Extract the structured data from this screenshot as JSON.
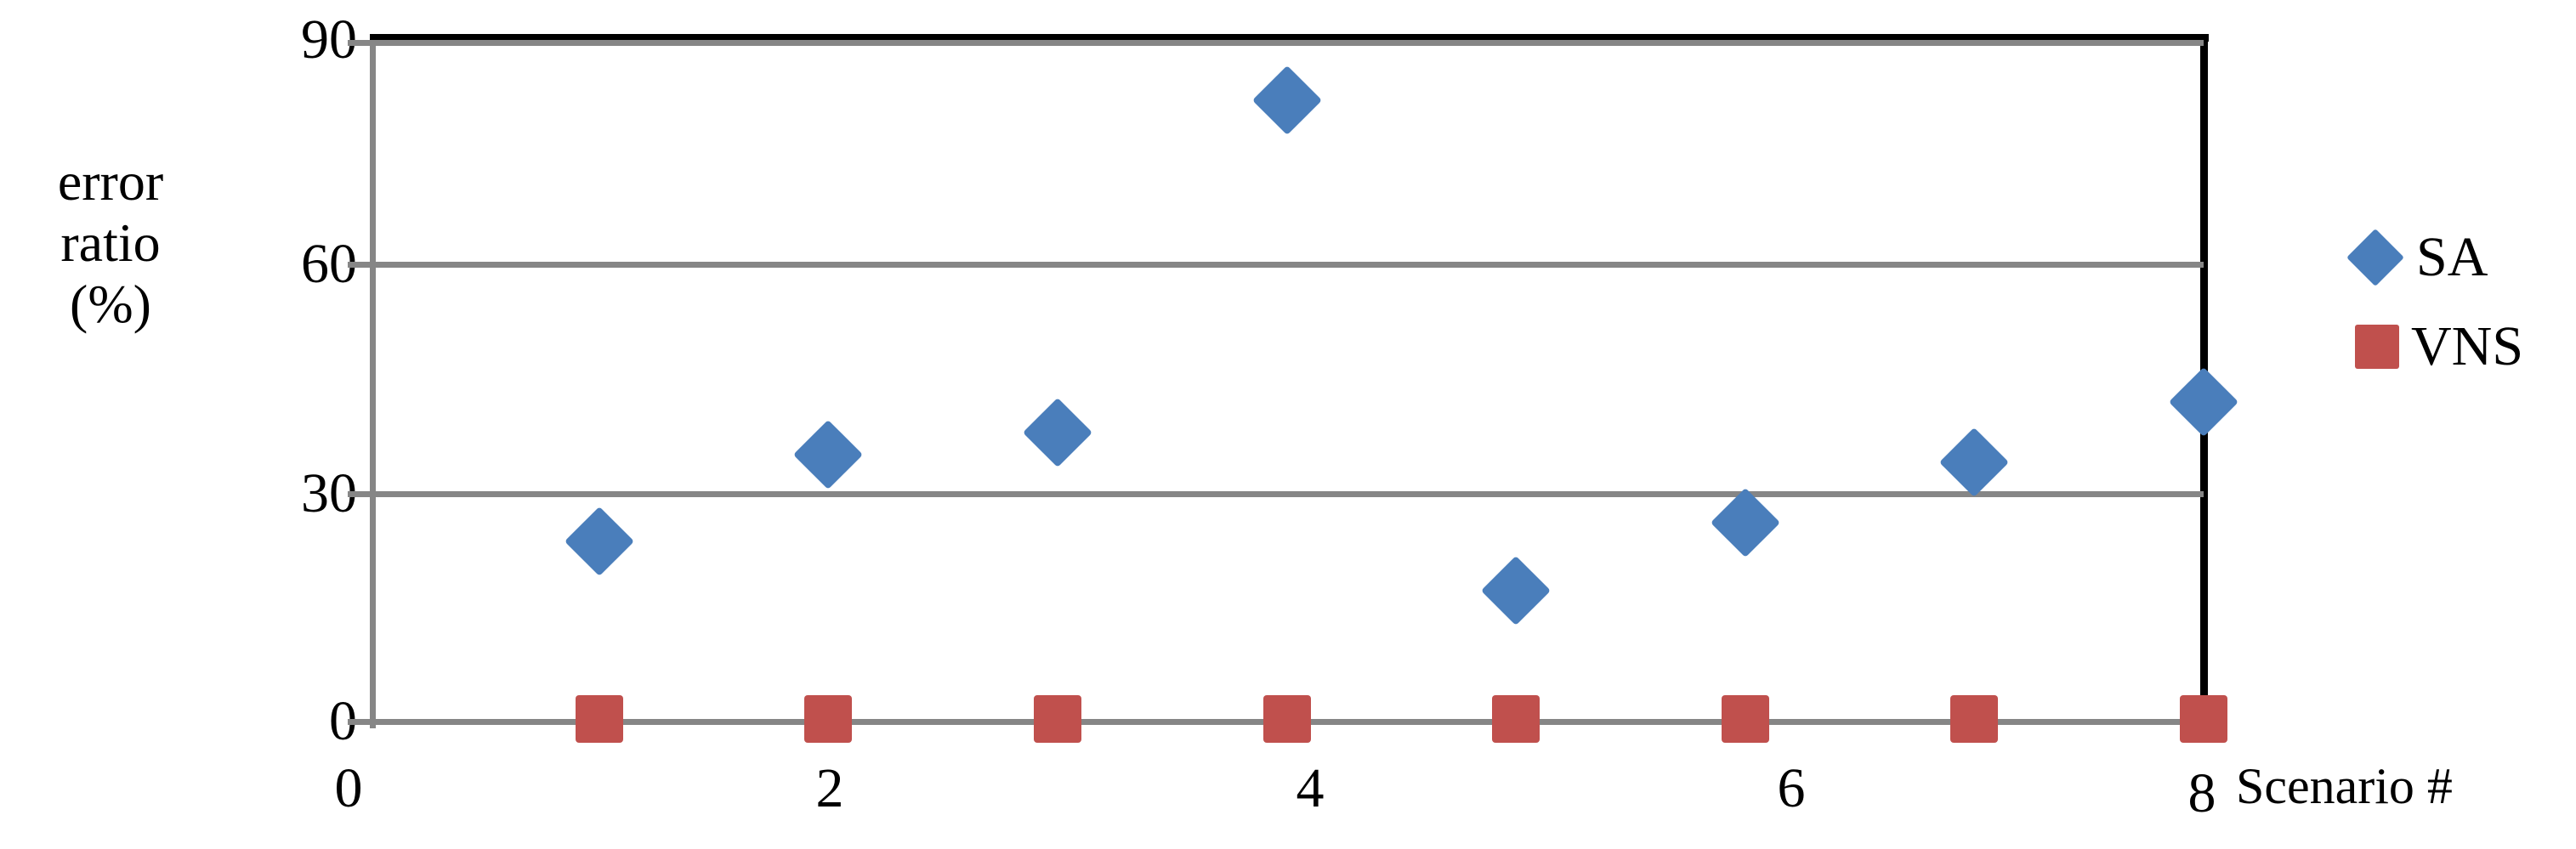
{
  "chart_data": {
    "type": "scatter",
    "title": "",
    "xlabel": "Scenario #",
    "ylabel": "error ratio (%)",
    "x": [
      1,
      2,
      3,
      4,
      5,
      6,
      7,
      8
    ],
    "xlim": [
      0,
      8
    ],
    "ylim": [
      0,
      90
    ],
    "xticks": [
      "0",
      "2",
      "4",
      "6",
      "8"
    ],
    "xtick_values": [
      0,
      2,
      4,
      6,
      8
    ],
    "yticks": [
      "0",
      "30",
      "60",
      "90"
    ],
    "ytick_values": [
      0,
      30,
      60,
      90
    ],
    "grid": "horizontal",
    "legend_position": "right",
    "series": [
      {
        "name": "SA",
        "marker": "diamond",
        "color": "#4a7ebb",
        "values": [
          23.5,
          35,
          38,
          82,
          17,
          26,
          34,
          42
        ]
      },
      {
        "name": "VNS",
        "marker": "square",
        "color": "#c0504d",
        "values": [
          0,
          0,
          0,
          0,
          0,
          0,
          0,
          0
        ]
      }
    ]
  },
  "axes": {
    "y_title": "error\nratio\n(%)",
    "x_title": "Scenario #",
    "y_tick_labels": [
      "90",
      "60",
      "30",
      "0"
    ],
    "x_tick_labels": [
      "0",
      "2",
      "4",
      "6",
      "8"
    ]
  },
  "legend": {
    "entries": [
      {
        "label": "SA",
        "marker": "diamond",
        "color": "#4a7ebb"
      },
      {
        "label": "VNS",
        "marker": "square",
        "color": "#c0504d"
      }
    ]
  },
  "colors": {
    "sa_blue": "#4a7ebb",
    "vns_red": "#c0504d",
    "gridline_gray": "#868686",
    "border_black": "#000000",
    "background": "#ffffff"
  }
}
